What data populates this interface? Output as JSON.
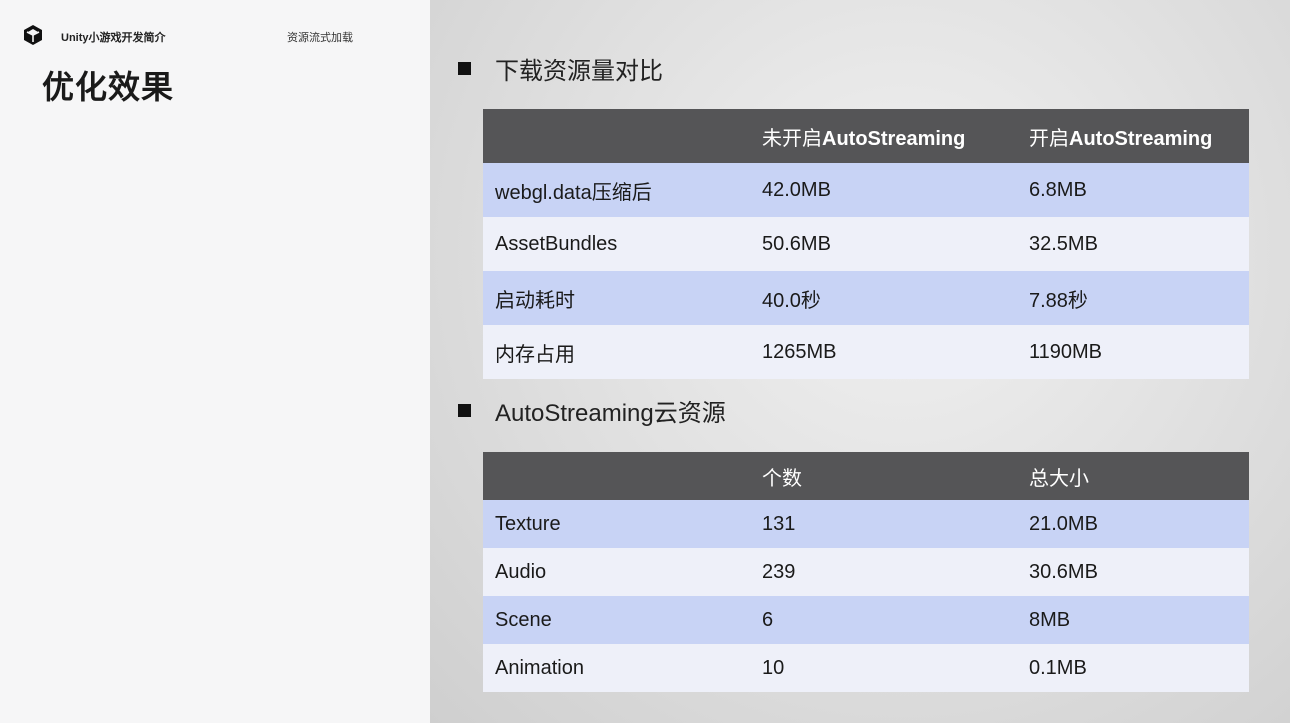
{
  "header": {
    "brand": "Unity小游戏开发简介",
    "section": "资源流式加载",
    "title": "优化效果"
  },
  "section1": {
    "heading": "下载资源量对比",
    "columns": [
      "",
      "未开启",
      "AutoStreaming",
      "开启",
      "AutoStreaming"
    ],
    "rows": [
      [
        "webgl.data压缩后",
        "42.0MB",
        "6.8MB"
      ],
      [
        "AssetBundles",
        "50.6MB",
        "32.5MB"
      ],
      [
        "启动耗时",
        "40.0秒",
        "7.88秒"
      ],
      [
        "内存占用",
        "1265MB",
        "1190MB"
      ]
    ]
  },
  "section2": {
    "heading": "AutoStreaming云资源",
    "columns": [
      "",
      "个数",
      "总大小"
    ],
    "rows": [
      [
        "Texture",
        "131",
        "21.0MB"
      ],
      [
        "Audio",
        "239",
        "30.6MB"
      ],
      [
        "Scene",
        "6",
        "8MB"
      ],
      [
        "Animation",
        "10",
        "0.1MB"
      ]
    ]
  },
  "colors": {
    "header_row": "#555557",
    "row_blue": "#c8d3f5",
    "row_light": "#eef0f9"
  }
}
